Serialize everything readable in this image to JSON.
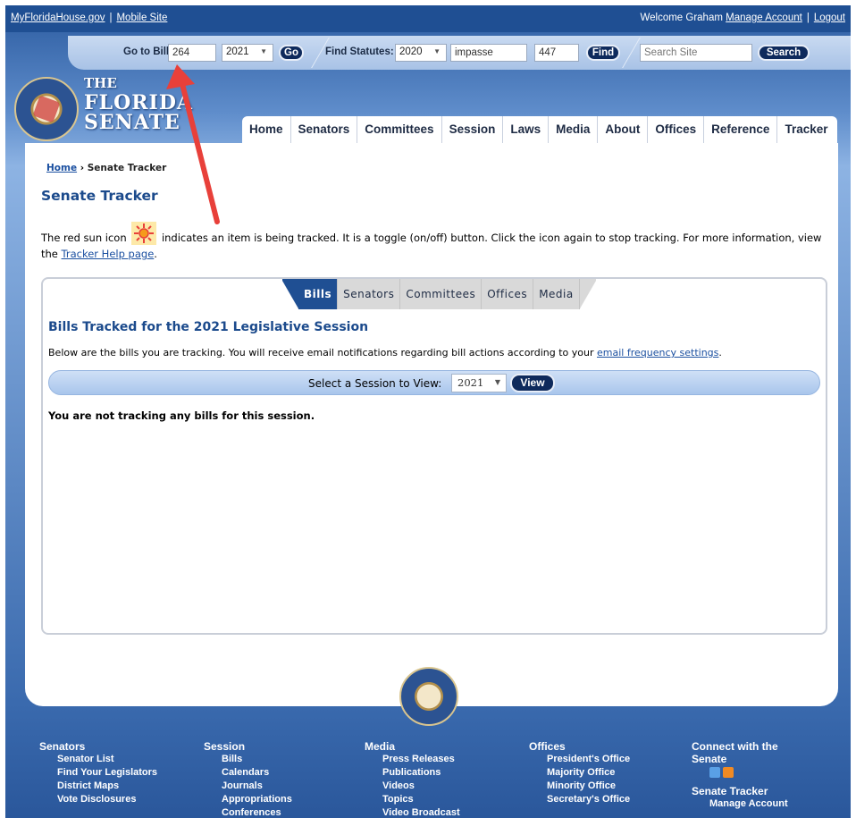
{
  "topbar": {
    "site_link": "MyFloridaHouse.gov",
    "mobile_link": "Mobile Site",
    "welcome": "Welcome Graham",
    "manage_account": "Manage Account",
    "logout": "Logout"
  },
  "toolbar": {
    "go_to_bill_label": "Go to Bill:",
    "bill_number": "264",
    "bill_year": "2021",
    "go_button": "Go",
    "find_statutes_label": "Find Statutes:",
    "statute_year": "2020",
    "statute_query": "impasse",
    "statute_number": "447",
    "find_button": "Find",
    "search_placeholder": "Search Site",
    "search_button": "Search"
  },
  "logo": {
    "line1": "THE",
    "line2": "FLORIDA",
    "line3": "SENATE"
  },
  "nav": [
    "Home",
    "Senators",
    "Committees",
    "Session",
    "Laws",
    "Media",
    "About",
    "Offices",
    "Reference",
    "Tracker"
  ],
  "breadcrumb": {
    "home": "Home",
    "sep": "›",
    "current": "Senate Tracker"
  },
  "page_title": "Senate Tracker",
  "intro": {
    "before_icon": "The red sun icon",
    "after_icon": "indicates an item is being tracked. It is a toggle (on/off) button. Click the icon again to stop tracking. For more information, view the",
    "help_link": "Tracker Help page",
    "end": "."
  },
  "tabs": [
    "Bills",
    "Senators",
    "Committees",
    "Offices",
    "Media"
  ],
  "panel": {
    "title": "Bills Tracked for the 2021 Legislative Session",
    "desc_before": "Below are the bills you are tracking. You will receive email notifications regarding bill actions according to your",
    "desc_link": "email frequency settings",
    "desc_end": ".",
    "session_label": "Select a Session to View:",
    "session_value": "2021",
    "view_button": "View",
    "empty_message": "You are not tracking any bills for this session."
  },
  "footer": {
    "senators": {
      "head": "Senators",
      "items": [
        "Senator List",
        "Find Your Legislators",
        "District Maps",
        "Vote Disclosures"
      ]
    },
    "session": {
      "head": "Session",
      "items": [
        "Bills",
        "Calendars",
        "Journals",
        "Appropriations",
        "Conferences"
      ]
    },
    "media": {
      "head": "Media",
      "items": [
        "Press Releases",
        "Publications",
        "Videos",
        "Topics",
        "Video Broadcast"
      ]
    },
    "offices": {
      "head": "Offices",
      "items": [
        "President's Office",
        "Majority Office",
        "Minority Office",
        "Secretary's Office"
      ]
    },
    "connect": {
      "head1": "Connect with the",
      "head2": "Senate",
      "tracker_head": "Senate Tracker",
      "tracker_item": "Manage Account"
    }
  },
  "colors": {
    "brand_blue": "#1f4f93",
    "accent_red": "#e8403a",
    "sun_orange": "#f59a1b"
  }
}
